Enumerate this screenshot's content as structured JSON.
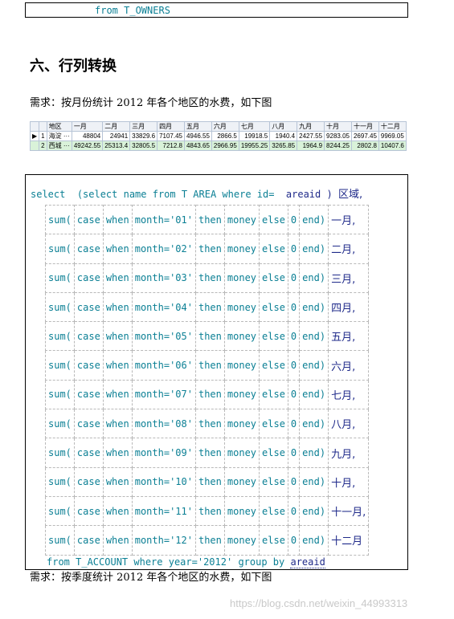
{
  "top_code": "from T_OWNERS",
  "heading": "六、行列转换",
  "requirement_1": "需求：按月份统计 2012 年各个地区的水费，如下图",
  "grid": {
    "headers": [
      "地区",
      "一月",
      "二月",
      "三月",
      "四月",
      "五月",
      "六月",
      "七月",
      "八月",
      "九月",
      "十月",
      "十一月",
      "十二月"
    ],
    "rows": [
      {
        "index": "1",
        "marker": "▶",
        "area": "海淀",
        "dots": "···",
        "values": [
          "48804",
          "24941",
          "33829.6",
          "7107.45",
          "4946.55",
          "2866.5",
          "19918.5",
          "1940.4",
          "2427.55",
          "9283.05",
          "2697.45",
          "9969.05"
        ]
      },
      {
        "index": "2",
        "marker": "",
        "area": "西城",
        "dots": "···",
        "values": [
          "49242.55",
          "25313.4",
          "32805.5",
          "7212.8",
          "4843.65",
          "2966.95",
          "19955.25",
          "3265.85",
          "1964.9",
          "8244.25",
          "2802.8",
          "10407.6"
        ]
      }
    ]
  },
  "sql": {
    "head": {
      "select": "select",
      "sub_open": "(select name from T AREA where id=",
      "areaid": "areaid",
      "sub_close": ")",
      "alias": "区域,"
    },
    "sum_rows": [
      {
        "month": "'01'",
        "alias": "一月,"
      },
      {
        "month": "'02'",
        "alias": "二月,"
      },
      {
        "month": "'03'",
        "alias": "三月,"
      },
      {
        "month": "'04'",
        "alias": "四月,"
      },
      {
        "month": "'05'",
        "alias": "五月,"
      },
      {
        "month": "'06'",
        "alias": "六月,"
      },
      {
        "month": "'07'",
        "alias": "七月,"
      },
      {
        "month": "'08'",
        "alias": "八月,"
      },
      {
        "month": "'09'",
        "alias": "九月,"
      },
      {
        "month": "'10'",
        "alias": "十月,"
      },
      {
        "month": "'11'",
        "alias": "十一月,"
      },
      {
        "month": "'12'",
        "alias": "十二月"
      }
    ],
    "tokens": {
      "sum": "sum(",
      "case": "case",
      "when": "when",
      "month_eq": "month=",
      "then": "then",
      "money": "money",
      "else": "else",
      "zero": "0",
      "end": "end)"
    },
    "foot": {
      "from": "from T_ACCOUNT where year=",
      "year": "'2012'",
      "group_by": "group by",
      "areaid": "areaid"
    }
  },
  "requirement_2": "需求：按季度统计 2012 年各个地区的水费，如下图",
  "watermark": "https://blog.csdn.net/weixin_44993313"
}
